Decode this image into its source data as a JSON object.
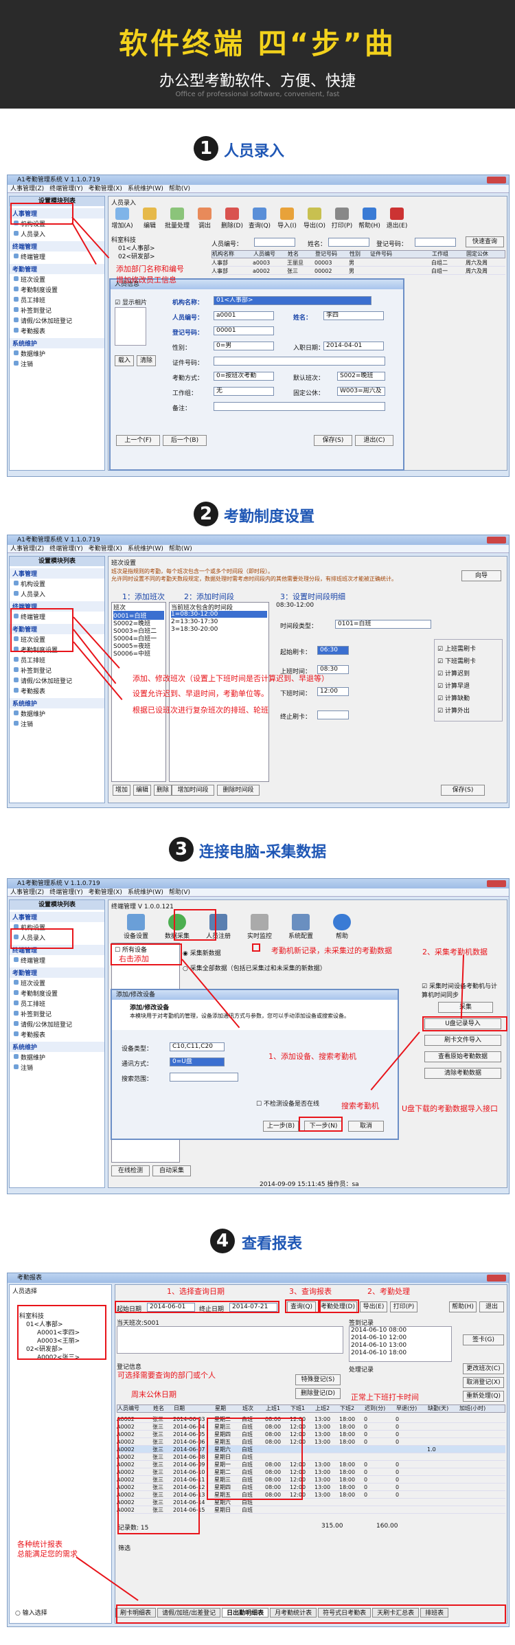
{
  "banner": {
    "title": "软件终端 四“步”曲",
    "subtitle": "办公型考勤软件、方便、快捷",
    "eng": "Office of professional software, convenient, fast"
  },
  "steps": [
    {
      "num": "1",
      "label": "人员录入"
    },
    {
      "num": "2",
      "label": "考勤制度设置"
    },
    {
      "num": "3",
      "label": "连接电脑-采集数据"
    },
    {
      "num": "4",
      "label": "查看报表"
    }
  ],
  "app": {
    "title": "A1考勤管理系统 V 1.1.0.719",
    "menu": [
      "人事管理(Z)",
      "终端管理(Y)",
      "考勤管理(X)",
      "系统维护(W)",
      "帮助(V)"
    ],
    "menu2": [
      "人事管理(Z)",
      "终端管理(Y)",
      "考勤管理(X)",
      "系统维护(W)",
      "帮助(W)"
    ]
  },
  "sidebar": {
    "header": "设置模块列表",
    "groups": [
      {
        "name": "人事管理",
        "items": [
          "机构设置",
          "人员录入"
        ]
      },
      {
        "name": "终端管理",
        "items": [
          "终端管理"
        ]
      },
      {
        "name": "考勤管理",
        "items": [
          "班次设置",
          "考勤制度设置",
          "员工排班",
          "补签到登记",
          "请假/公休加班登记",
          "考勤报表"
        ]
      },
      {
        "name": "系统维护",
        "items": [
          "数据维护",
          "注销"
        ]
      }
    ]
  },
  "s1": {
    "window": "人员录入",
    "toolbar": [
      "增加(A)",
      "编辑",
      "批量处理",
      "调出",
      "删除(D)",
      "查询(Q)",
      "导入(I)",
      "导出(O)",
      "打印(P)",
      "帮助(H)",
      "退出(E)"
    ],
    "tree": [
      "科室科技",
      "01<人事部>",
      "02<研发部>"
    ],
    "filter": {
      "p": "人员编号：",
      "n": "姓名：",
      "r": "登记号码：",
      "quick": "快速查询"
    },
    "cols": [
      "机构名称",
      "人员编号",
      "姓名",
      "登记号码",
      "性别",
      "证件号码",
      "工作组",
      "固定公休"
    ],
    "rows": [
      [
        "人事部",
        "a0003",
        "王丽旦",
        "00003",
        "男",
        "",
        "白组二",
        "周六及周"
      ],
      [
        "人事部",
        "a0002",
        "张三",
        "00002",
        "男",
        "",
        "白组一",
        "周六及周"
      ]
    ],
    "dialog": {
      "title": "人员信息",
      "photo": "显示相片",
      "org_l": "机构名称：",
      "org": "01<人事部>",
      "pid_l": "人员编号：",
      "pid": "a0001",
      "name_l": "姓名：",
      "name": "李四",
      "reg_l": "登记号码：",
      "reg": "00001",
      "sex_l": "性别：",
      "sex": "0=男",
      "date_l": "入职日期：",
      "date": "2014-04-01",
      "card_l": "证件号码：",
      "mode_l": "考勤方式：",
      "mode": "0=按班次考勤",
      "shift_l": "默认班次：",
      "shift": "S002=晚班",
      "grp_l": "工作组：",
      "grp": "无",
      "holi_l": "固定公休：",
      "holi": "W003=周六及",
      "note_l": "备注：",
      "b_in": "载入",
      "b_clr": "清除",
      "prev": "上一个(F)",
      "next": "后一个(B)",
      "save": "保存(S)",
      "exit": "退出(C)"
    },
    "ann1": "添加部门名称和编号",
    "ann2": "增加修改员工信息"
  },
  "s2": {
    "window": "班次设置",
    "notice": "班次是指规则的考勤，每个班次包含一个或多个时间段（即时段）。\n允许同时设置不同的考勤天数段规定，数据处理时需考虑时间段内的其他需要处理分段，有排班班次才能被正确统计。",
    "guide": "向导",
    "h1": "1：添加班次",
    "h2": "2：添加时间段",
    "h3": "3：设置时间段明细",
    "shift_col": "班次",
    "shifts": [
      "0001=白班",
      "S0002=晚班",
      "S0003=白班二",
      "S0004=白班一",
      "S0005=夜班",
      "S0006=中班"
    ],
    "seg_col": "当前班次包含的时间段",
    "segs": [
      "1=08:30-12:00",
      "2=13:30-17:30",
      "3=18:30-20:00"
    ],
    "range": "08:30-12:00",
    "type_l": "时间段类型：",
    "type": "0101=白班",
    "start_l": "起始刷卡：",
    "start": "06:30",
    "on_l": "上班时间：",
    "on": "08:30",
    "off_l": "下班时间：",
    "off": "12:00",
    "end_l": "终止刷卡：",
    "checks": [
      "上班需刷卡",
      "下班需刷卡",
      "计算迟到",
      "计算早退",
      "计算缺勤",
      "计算外出"
    ],
    "btns": [
      "增加",
      "编辑",
      "删除",
      "增加时间段",
      "删除时间段",
      "保存(S)"
    ],
    "ann1": "添加、修改班次（设置上下班时间是否计算迟到、早退等）",
    "ann2": "设置允许迟到、早退时间，考勤单位等。",
    "ann3": "根据已设班次进行复杂班次的排班、轮班"
  },
  "s3": {
    "window": "终端管理 V 1.0.0.121",
    "icons": [
      "设备设置",
      "数据采集",
      "人员注册",
      "实时监控",
      "系统配置",
      "帮助"
    ],
    "all_dev": "所有设备",
    "right_click": "右击添加",
    "opt1": "采集新数据",
    "opt2": "采集全部数据（包括已采集过和未采集的新数据）",
    "ann_new": "考勤机新记录，未采集过的考勤数据",
    "ann_collect": "2、采集考勤机数据",
    "collect_chk": "采集时间设备考勤机与计算机时间同步",
    "collect": "采集",
    "udisk": "U盘记录导入",
    "card": "刷卡文件导入",
    "view": "查看原始考勤数据",
    "clear": "清除考勤数据",
    "dlg_title": "添加/修改设备",
    "dlg_head": "添加/修改设备",
    "dlg_text": "本模块用于对考勤机的管理，设备添加通讯方式与参数，您可以手动添加设备或搜索设备。",
    "dev_type_l": "设备类型：",
    "dev_type": "C10,C11,C20",
    "comm_l": "通讯方式：",
    "comm": "0=U盘",
    "ip_l": "搜索范围：",
    "chk": "不检测设备是否在线",
    "back": "上一步(B)",
    "nextb": "下一步(N)",
    "cancel": "取消",
    "ann_add": "1、添加设备、搜索考勤机",
    "ann_search": "搜索考勤机",
    "ann_udisk": "U盘下载的考勤数据导入接口",
    "online": "在线检测",
    "auto": "自动采集",
    "status": "2014-09-09 15:11:45 操作员：sa"
  },
  "s4": {
    "window": "考勤报表",
    "tree_title": "人员选择",
    "tree": [
      "科室科技",
      "01<人事部>",
      "A0001<李四>",
      "A0003<王丽>",
      "02<研发部>",
      "A0002<张三>"
    ],
    "start_l": "起始日期",
    "start": "2014-06-01",
    "end_l": "终止日期",
    "end": "2014-07-21",
    "query": "查询(Q)",
    "process": "考勤处理(D)",
    "export": "导出(E)",
    "print": "打印(P)",
    "help": "帮助(H)",
    "exit": "退出",
    "ann1": "1、选择查询日期",
    "ann3": "3、查询报表",
    "ann2": "2、考勤处理",
    "ann_dept": "可选择需要查询的部门或个人",
    "ann_week": "周末公休日期",
    "ann_norm": "正常上下班打卡时间",
    "ann_all": "各种统计报表",
    "ann_all2": "总能满足您的需求",
    "cur_shift": "当天班次:S001",
    "sign_rec": "签到记录",
    "sign_times": [
      "2014-06-10 08:00",
      "2014-06-10 12:00",
      "2014-06-10 13:00",
      "2014-06-10 18:00"
    ],
    "reg_info": "登记信息",
    "special": "特殊登记(S)",
    "del_reg": "删除登记(D)",
    "proc_rec": "处理记录",
    "edit_shift": "更改班次(C)",
    "cancel_reg": "取消登记(X)",
    "reprocess": "重新处理(Q)",
    "sign_card": "签卡(G)",
    "cols": [
      "人员编号",
      "姓名",
      "日期",
      "星期",
      "班次",
      "上班1",
      "下班1",
      "上班2",
      "下班2",
      "迟到(分)",
      "早退(分)",
      "缺勤(天)",
      "加班(小时)"
    ],
    "rows": [
      [
        "A0002",
        "张三",
        "2014-06-03",
        "星期二",
        "白班",
        "08:00",
        "12:00",
        "13:00",
        "18:00",
        "0",
        "0",
        "",
        ""
      ],
      [
        "A0002",
        "张三",
        "2014-06-04",
        "星期三",
        "白班",
        "08:00",
        "12:00",
        "13:00",
        "18:00",
        "0",
        "0",
        "",
        ""
      ],
      [
        "A0002",
        "张三",
        "2014-06-05",
        "星期四",
        "白班",
        "08:00",
        "12:00",
        "13:00",
        "18:00",
        "0",
        "0",
        "",
        ""
      ],
      [
        "A0002",
        "张三",
        "2014-06-06",
        "星期五",
        "白班",
        "08:00",
        "12:00",
        "13:00",
        "18:00",
        "0",
        "0",
        "",
        ""
      ],
      [
        "A0002",
        "张三",
        "2014-06-07",
        "星期六",
        "白班",
        "",
        "",
        "",
        "",
        "",
        "",
        "1.0",
        ""
      ],
      [
        "A0002",
        "张三",
        "2014-06-08",
        "星期日",
        "白班",
        "",
        "",
        "",
        "",
        "",
        "",
        "",
        ""
      ],
      [
        "A0002",
        "张三",
        "2014-06-09",
        "星期一",
        "白班",
        "08:00",
        "12:00",
        "13:00",
        "18:00",
        "0",
        "0",
        "",
        ""
      ],
      [
        "A0002",
        "张三",
        "2014-06-10",
        "星期二",
        "白班",
        "08:00",
        "12:00",
        "13:00",
        "18:00",
        "0",
        "0",
        "",
        ""
      ],
      [
        "A0002",
        "张三",
        "2014-06-11",
        "星期三",
        "白班",
        "08:00",
        "12:00",
        "13:00",
        "18:00",
        "0",
        "0",
        "",
        ""
      ],
      [
        "A0002",
        "张三",
        "2014-06-12",
        "星期四",
        "白班",
        "08:00",
        "12:00",
        "13:00",
        "18:00",
        "0",
        "0",
        "",
        ""
      ],
      [
        "A0002",
        "张三",
        "2014-06-13",
        "星期五",
        "白班",
        "08:00",
        "12:00",
        "13:00",
        "18:00",
        "0",
        "0",
        "",
        ""
      ],
      [
        "A0002",
        "张三",
        "2014-06-14",
        "星期六",
        "白班",
        "",
        "",
        "",
        "",
        "",
        "",
        "",
        ""
      ],
      [
        "A0002",
        "张三",
        "2014-06-15",
        "星期日",
        "白班",
        "",
        "",
        "",
        "",
        "",
        "",
        "",
        ""
      ]
    ],
    "count": "记录数: 15",
    "sum": "315.00",
    "sum2": "160.00",
    "filter": "筛选",
    "tabs": [
      "刷卡明细表",
      "请假/加班/出差登记",
      "日出勤明细表",
      "月考勤统计表",
      "符号式日考勤表",
      "天刷卡汇总表",
      "排班表"
    ],
    "input": "输入选择"
  }
}
